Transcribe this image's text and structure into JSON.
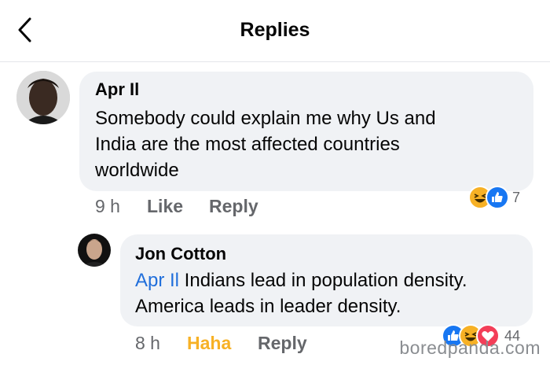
{
  "header": {
    "title": "Replies",
    "back_icon": "chevron-left-icon"
  },
  "comment": {
    "author": "Apr Il",
    "text": "Somebody could explain me why Us and India are the most affected countries worldwide",
    "line1": "Somebody could explain me why Us and",
    "line2": "India are the most affected countries",
    "line3": "worldwide",
    "time": "9 h",
    "like_label": "Like",
    "reply_label": "Reply",
    "reactions": [
      "haha-icon",
      "like-icon"
    ],
    "reaction_count": "7"
  },
  "reply": {
    "author": "Jon Cotton",
    "mention": "Apr Il",
    "line1_rest": " Indians lead in population density.",
    "line2": "America leads in leader density.",
    "time": "8 h",
    "haha_label": "Haha",
    "reply_label": "Reply",
    "reactions": [
      "like-icon",
      "haha-icon",
      "love-icon"
    ],
    "reaction_count": "44"
  },
  "watermark": "boredpanda.com",
  "colors": {
    "bubble": "#f0f2f5",
    "mention": "#216fdb",
    "like_blue": "#1877f2",
    "haha_yellow": "#f7b125",
    "love_red": "#f33e58",
    "meta_gray": "#65676b"
  }
}
